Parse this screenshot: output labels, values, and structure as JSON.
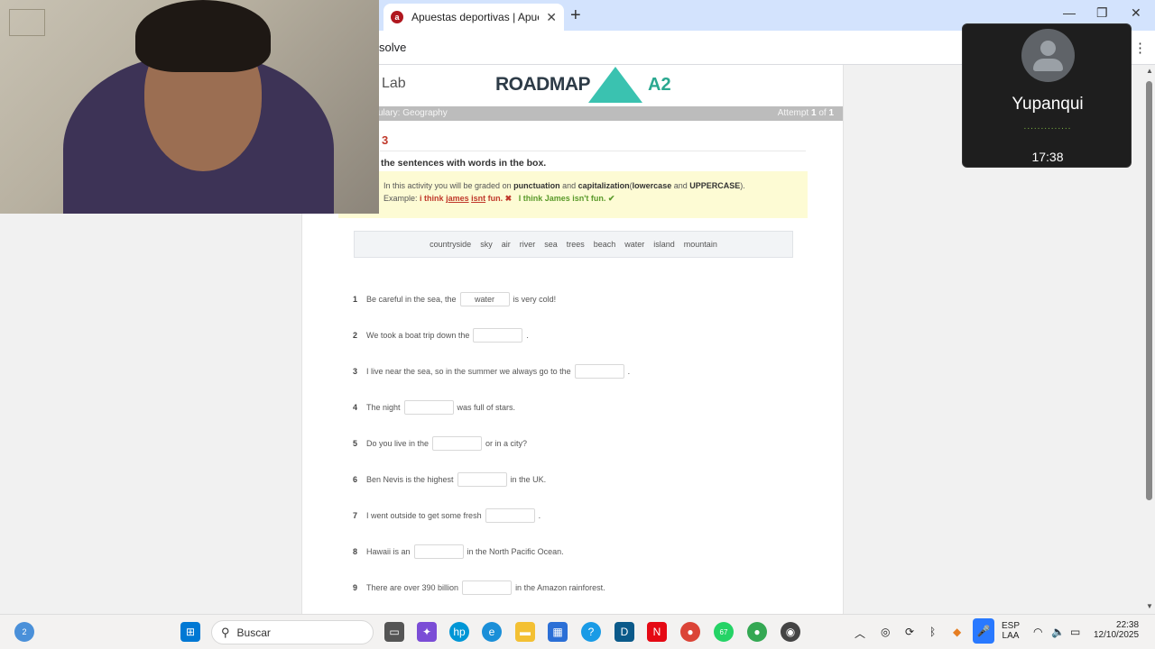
{
  "browser": {
    "tab_title": "Apuestas deportivas | Apuestas",
    "tab_close": "✕",
    "new_tab": "+",
    "url_fragment": "solve",
    "min": "—",
    "restore": "❐",
    "close": "✕",
    "menu": "⋮"
  },
  "page": {
    "lab_title": "Lab",
    "logo_word": "ROADMAP",
    "logo_level": "A2",
    "breadcrumb": "ulary: Geography",
    "attempt_prefix": "Attempt",
    "attempt_current": "1",
    "attempt_of": "of",
    "attempt_total": "1",
    "exercise_number": "3",
    "instruction": "the sentences with words in the box.",
    "notice_l1_a": "In this activity you will be graded on",
    "notice_l1_b": "punctuation",
    "notice_l1_c": "and",
    "notice_l1_d": "capitalization",
    "notice_l1_e": "(",
    "notice_l1_f": "lowercase",
    "notice_l1_g": "and",
    "notice_l1_h": "UPPERCASE",
    "notice_l1_i": ").",
    "example_label": "Example:",
    "example_wrong_a": "i think",
    "example_wrong_b": "james",
    "example_wrong_c": "isnt",
    "example_wrong_d": "fun.",
    "cross": "✖",
    "example_right": "I think James isn't fun.",
    "check": "✔",
    "words": [
      "countryside",
      "sky",
      "air",
      "river",
      "sea",
      "trees",
      "beach",
      "water",
      "island",
      "mountain"
    ],
    "questions": [
      {
        "num": "1",
        "before": "Be careful in the sea, the",
        "answer": "water",
        "after": "is very cold!"
      },
      {
        "num": "2",
        "before": "We took a boat trip down the",
        "answer": "",
        "after": "."
      },
      {
        "num": "3",
        "before": "I live near the sea, so in the summer we always go to the",
        "answer": "",
        "after": "."
      },
      {
        "num": "4",
        "before": "The night",
        "answer": "",
        "after": "was full of stars."
      },
      {
        "num": "5",
        "before": "Do you live in the",
        "answer": "",
        "after": "or in a city?"
      },
      {
        "num": "6",
        "before": "Ben Nevis is the highest",
        "answer": "",
        "after": "in the UK."
      },
      {
        "num": "7",
        "before": "I went outside to get some fresh",
        "answer": "",
        "after": "."
      },
      {
        "num": "8",
        "before": "Hawaii is an",
        "answer": "",
        "after": "in the North Pacific Ocean."
      },
      {
        "num": "9",
        "before": "There are over 390 billion",
        "answer": "",
        "after": "in the Amazon rainforest."
      }
    ]
  },
  "call": {
    "name": "Yupanqui",
    "dots": "..............",
    "time": "17:38"
  },
  "taskbar": {
    "search_placeholder": "Buscar",
    "weather_badge": "2",
    "whatsapp_badge": "67",
    "lang_1": "ESP",
    "lang_2": "LAA",
    "time": "22:38",
    "date": "12/10/2025"
  },
  "colors": {
    "accent_red": "#c0392b",
    "logo_teal": "#3ac2b0",
    "notice_bg": "#fdfbd4"
  }
}
